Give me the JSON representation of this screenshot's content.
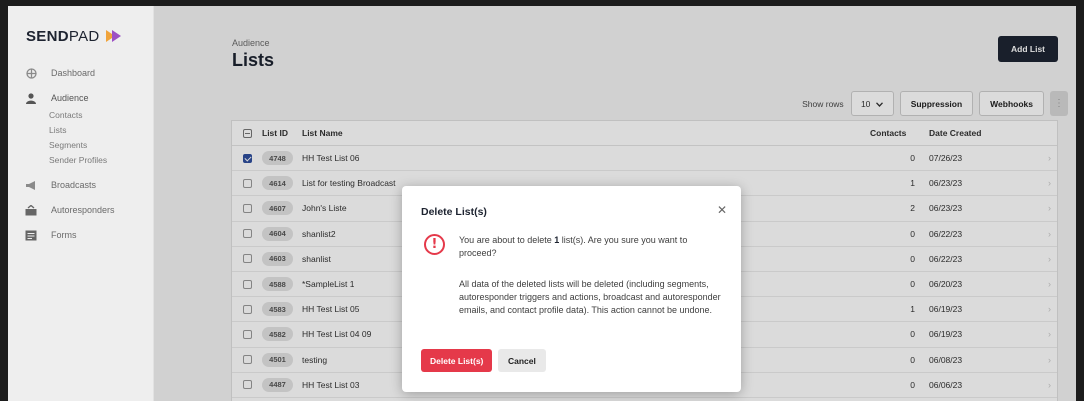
{
  "brand": {
    "name_bold": "SEND",
    "name_rest": "PAD"
  },
  "sidebar": {
    "items": [
      {
        "label": "Dashboard",
        "icon": "dashboard-icon"
      },
      {
        "label": "Audience",
        "icon": "users-icon"
      },
      {
        "label": "Broadcasts",
        "icon": "megaphone-icon"
      },
      {
        "label": "Autoresponders",
        "icon": "inbox-icon"
      },
      {
        "label": "Forms",
        "icon": "form-icon"
      }
    ],
    "sub_items": [
      "Contacts",
      "Lists",
      "Segments",
      "Sender Profiles"
    ]
  },
  "header": {
    "breadcrumb": "Audience",
    "title": "Lists",
    "add_button": "Add List"
  },
  "toolbar": {
    "show_rows_label": "Show rows",
    "rows_value": "10",
    "suppression": "Suppression",
    "webhooks": "Webhooks"
  },
  "table": {
    "columns": [
      "List ID",
      "List Name",
      "Contacts",
      "Date Created"
    ],
    "rows": [
      {
        "id": "4748",
        "name": "HH Test List 06",
        "contacts": "0",
        "date": "07/26/23",
        "checked": true
      },
      {
        "id": "4614",
        "name": "List for testing Broadcast",
        "contacts": "1",
        "date": "06/23/23",
        "checked": false
      },
      {
        "id": "4607",
        "name": "John's Liste",
        "contacts": "2",
        "date": "06/23/23",
        "checked": false
      },
      {
        "id": "4604",
        "name": "shanlist2",
        "contacts": "0",
        "date": "06/22/23",
        "checked": false
      },
      {
        "id": "4603",
        "name": "shanlist",
        "contacts": "0",
        "date": "06/22/23",
        "checked": false
      },
      {
        "id": "4588",
        "name": "*SampleList 1",
        "contacts": "0",
        "date": "06/20/23",
        "checked": false
      },
      {
        "id": "4583",
        "name": "HH Test List 05",
        "contacts": "1",
        "date": "06/19/23",
        "checked": false
      },
      {
        "id": "4582",
        "name": "HH Test List 04 09",
        "contacts": "0",
        "date": "06/19/23",
        "checked": false
      },
      {
        "id": "4501",
        "name": "testing",
        "contacts": "0",
        "date": "06/08/23",
        "checked": false
      },
      {
        "id": "4487",
        "name": "HH Test List 03",
        "contacts": "0",
        "date": "06/06/23",
        "checked": false
      }
    ]
  },
  "modal": {
    "title": "Delete List(s)",
    "message_pre": "You are about to delete ",
    "message_count": "1",
    "message_post": " list(s). Are you sure you want to proceed?",
    "detail": "All data of the deleted lists will be deleted (including segments, autoresponder triggers and actions, broadcast and autoresponder emails, and contact profile data). This action cannot be undone.",
    "confirm_button": "Delete List(s)",
    "cancel_button": "Cancel"
  },
  "colors": {
    "brand_dark": "#1e2533",
    "danger": "#e5394a",
    "checkbox": "#2f4f9e"
  }
}
